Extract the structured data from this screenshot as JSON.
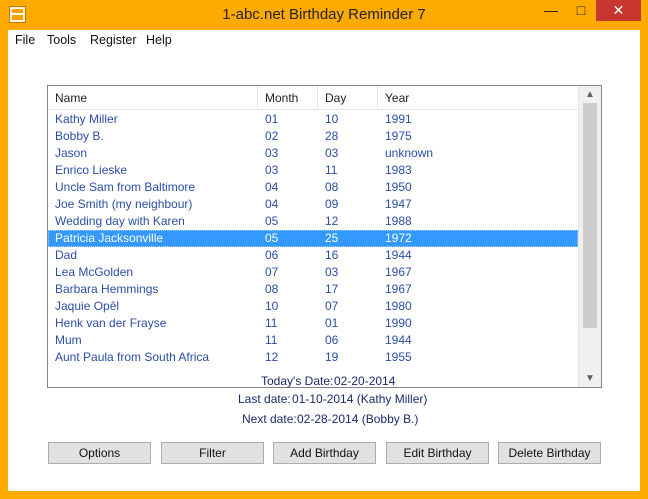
{
  "window": {
    "title": "1-abc.net Birthday Reminder 7"
  },
  "menu": [
    "File",
    "Tools",
    "Register",
    "Help"
  ],
  "columns": [
    "Name",
    "Month",
    "Day",
    "Year"
  ],
  "rows": [
    {
      "name": "Kathy Miller",
      "month": "01",
      "day": "10",
      "year": "1991"
    },
    {
      "name": "Bobby B.",
      "month": "02",
      "day": "28",
      "year": "1975"
    },
    {
      "name": "Jason",
      "month": "03",
      "day": "03",
      "year": "unknown"
    },
    {
      "name": "Enrico Lieske",
      "month": "03",
      "day": "11",
      "year": "1983"
    },
    {
      "name": "Uncle Sam from Baltimore",
      "month": "04",
      "day": "08",
      "year": "1950"
    },
    {
      "name": "Joe Smith (my neighbour)",
      "month": "04",
      "day": "09",
      "year": "1947"
    },
    {
      "name": "Wedding day with Karen",
      "month": "05",
      "day": "12",
      "year": "1988"
    },
    {
      "name": "Patricia Jacksonville",
      "month": "05",
      "day": "25",
      "year": "1972",
      "selected": true
    },
    {
      "name": "Dad",
      "month": "06",
      "day": "16",
      "year": "1944"
    },
    {
      "name": "Lea McGolden",
      "month": "07",
      "day": "03",
      "year": "1967"
    },
    {
      "name": "Barbara Hemmings",
      "month": "08",
      "day": "17",
      "year": "1967"
    },
    {
      "name": "Jaquie Opêl",
      "month": "10",
      "day": "07",
      "year": "1980"
    },
    {
      "name": "Henk van der Frayse",
      "month": "11",
      "day": "01",
      "year": "1990"
    },
    {
      "name": "Mum",
      "month": "11",
      "day": "06",
      "year": "1944"
    },
    {
      "name": "Aunt Paula from South Africa",
      "month": "12",
      "day": "19",
      "year": "1955"
    }
  ],
  "info": {
    "today_label": "Today's Date:",
    "today_value": "02-20-2014",
    "last_label": "Last date:",
    "last_value": "01-10-2014  (Kathy Miller)",
    "next_label": "Next date:",
    "next_value": "02-28-2014  (Bobby B.)"
  },
  "buttons": {
    "options": "Options",
    "filter": "Filter",
    "add": "Add Birthday",
    "edit": "Edit Birthday",
    "delete": "Delete Birthday"
  },
  "colors": {
    "title_bar": "#ffaa00",
    "selection": "#3399ff",
    "row_text": "#2a4ea6",
    "close_button": "#c7372f"
  }
}
